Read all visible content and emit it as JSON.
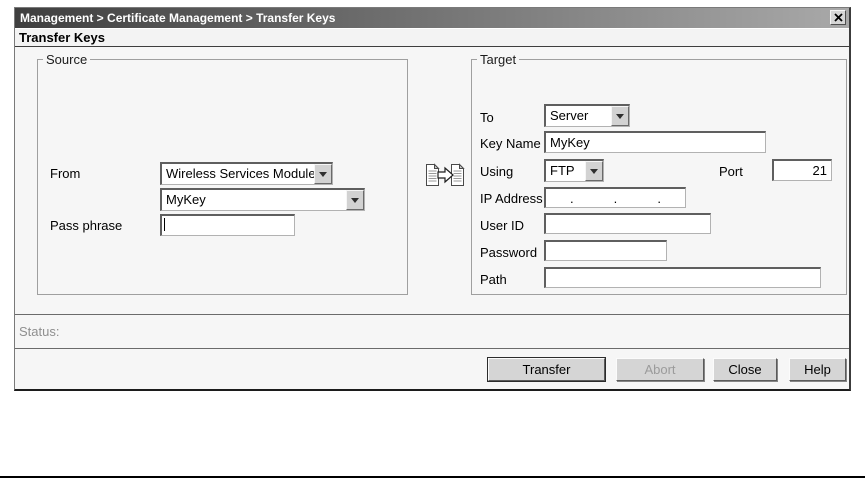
{
  "window": {
    "title": "Management > Certificate Management > Transfer Keys"
  },
  "page_heading": "Transfer Keys",
  "source": {
    "legend": "Source",
    "from_label": "From",
    "from_value": "Wireless Services Module",
    "key_select_value": "MyKey",
    "pass_phrase_label": "Pass phrase",
    "pass_phrase_value": ""
  },
  "target": {
    "legend": "Target",
    "to_label": "To",
    "to_value": "Server",
    "key_name_label": "Key Name",
    "key_name_value": "MyKey",
    "using_label": "Using",
    "using_value": "FTP",
    "port_label": "Port",
    "port_value": "21",
    "ip_label": "IP Address",
    "ip_dots": [
      ".",
      ".",
      "."
    ],
    "user_id_label": "User ID",
    "user_id_value": "",
    "password_label": "Password",
    "password_value": "",
    "path_label": "Path",
    "path_value": ""
  },
  "status": {
    "label": "Status:",
    "value": ""
  },
  "buttons": {
    "transfer": "Transfer",
    "abort": "Abort",
    "close": "Close",
    "help": "Help"
  },
  "icons": {
    "close_icon": "x",
    "transfer_icon": "copy-document-arrow",
    "combo_arrow": "chevron-down"
  },
  "colors": {
    "titlebar_gradient_start": "#3f3f3f",
    "titlebar_gradient_end": "#a9a9a9",
    "dialog_background": "#f6f6f6",
    "disabled_text": "#9b9b9b",
    "separator": "#6b6b6b"
  }
}
